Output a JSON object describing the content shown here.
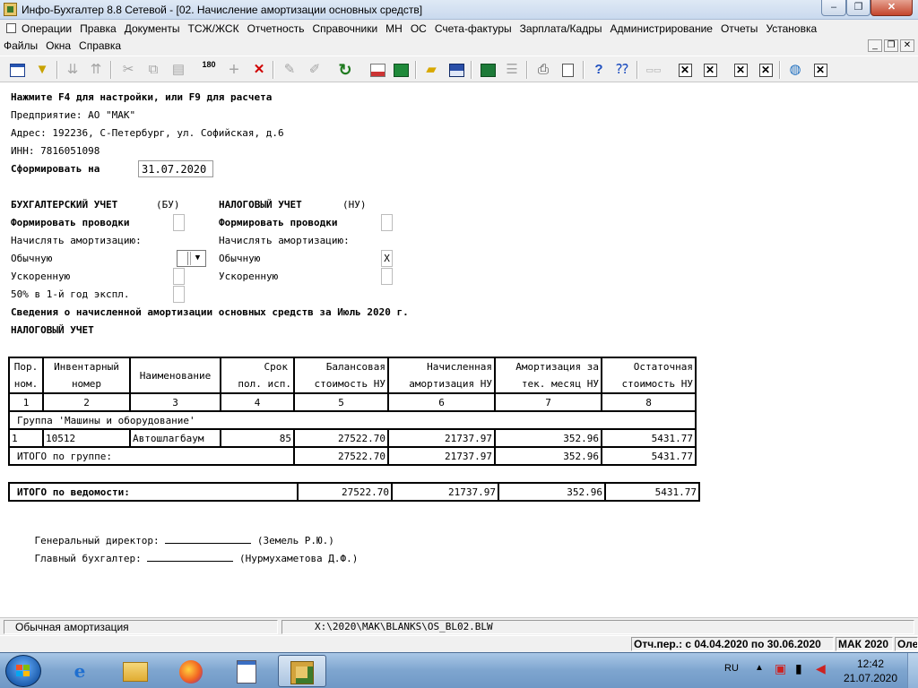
{
  "window": {
    "title": "Инфо-Бухгалтер 8.8 Сетевой - [02.  Начисление амортизации основных средств]",
    "min_glyph": "–",
    "max_glyph": "❐",
    "close_glyph": "✕"
  },
  "menu": {
    "row1": [
      "Операции",
      "Правка",
      "Документы",
      "ТСЖ/ЖСК",
      "Отчетность",
      "Справочники",
      "МН",
      "ОС",
      "Счета-фактуры",
      "Зарплата/Кадры",
      "Администрирование",
      "Отчеты",
      "Установка"
    ],
    "row2": [
      "Файлы",
      "Окна",
      "Справка"
    ],
    "mdi": {
      "min": "_",
      "restore": "❐",
      "close": "✕"
    }
  },
  "toolbar": {
    "icons": [
      "report-icon",
      "filter-icon",
      "sort-asc-icon",
      "sort-desc-icon",
      "cut-icon",
      "copy-icon",
      "paste-icon",
      "rotate-180-icon",
      "add-icon",
      "delete-icon",
      "post-icon",
      "unpost-icon",
      "refresh-icon",
      "pdf-icon",
      "calculator-icon",
      "open-folder-icon",
      "save-icon",
      "excel-icon",
      "list-icon",
      "print-icon",
      "preview-icon",
      "help-icon",
      "context-help-icon",
      "spellcheck-icon",
      "close-box-icon",
      "globe-icon"
    ],
    "rotate_label": "180",
    "x_glyph": "✕",
    "add_glyph": "+"
  },
  "report": {
    "hint": "Нажмите F4 для настройки, или F9 для расчета",
    "enterprise": "Предприятие: АО \"МАК\"",
    "address": "Адрес: 192236, С-Петербург, ул. Софийская, д.6",
    "inn": "ИНН: 7816051098",
    "form_on_label": "Сформировать на",
    "form_on_date": "31.07.2020",
    "bu": {
      "title": "БУХГАЛТЕРСКИЙ УЧЕТ",
      "abbr": "(БУ)",
      "post_label": "Формировать проводки",
      "amort_label": "Начислять амортизацию:",
      "regular_label": "Обычную",
      "accelerated_label": "Ускоренную",
      "fifty_label": "50% в 1-й год экспл.",
      "dropdown_arrow": "▼"
    },
    "nu": {
      "title": "НАЛОГОВЫЙ УЧЕТ",
      "abbr": "(НУ)",
      "post_label": "Формировать проводки",
      "amort_label": "Начислять амортизацию:",
      "regular_label": "Обычную",
      "regular_value": "X",
      "accelerated_label": "Ускоренную"
    },
    "statement_title": "Сведения о начисленной амортизации основных средств за Июль 2020 г.",
    "section_title": "НАЛОГОВЫЙ УЧЕТ",
    "table": {
      "headers": [
        [
          "Пор.",
          "ном."
        ],
        [
          "Инвентарный",
          "номер"
        ],
        [
          "Наименование",
          ""
        ],
        [
          "Срок",
          "пол. исп."
        ],
        [
          "Балансовая",
          "стоимость НУ"
        ],
        [
          "Начисленная",
          "амортизация НУ"
        ],
        [
          "Амортизация за",
          "тек. месяц НУ"
        ],
        [
          "Остаточная",
          "стоимость НУ"
        ]
      ],
      "col_numbers": [
        "1",
        "2",
        "3",
        "4",
        "5",
        "6",
        "7",
        "8"
      ],
      "group_title": "Группа 'Машины и оборудование'",
      "rows": [
        [
          "1",
          "10512",
          "Автошлагбаум",
          "85",
          "27522.70",
          "21737.97",
          "352.96",
          "5431.77"
        ]
      ],
      "group_total_label": "ИТОГО по группе:",
      "group_total": [
        "27522.70",
        "21737.97",
        "352.96",
        "5431.77"
      ],
      "grand_total_label": "ИТОГО по ведомости:",
      "grand_total": [
        "27522.70",
        "21737.97",
        "352.96",
        "5431.77"
      ]
    },
    "director_label": "Генеральный директор:",
    "director_name": "(Земель Р.Ю.)",
    "accountant_label": "Главный бухгалтер:",
    "accountant_name": "(Нурмухаметова Д.Ф.)"
  },
  "status": {
    "left": "Обычная амортизация",
    "path": "X:\\2020\\MAK\\BLANKS\\OS_BL02.BLW",
    "period": "Отч.пер.: с 04.04.2020 по 30.06.2020",
    "org": "МАК 2020",
    "extra": "Оле"
  },
  "taskbar": {
    "apps": [
      "explorer-ie-icon",
      "file-manager-icon",
      "firefox-icon",
      "document-icon",
      "info-buhgalter-icon"
    ],
    "lang": "RU",
    "time": "12:42",
    "date": "21.07.2020"
  }
}
